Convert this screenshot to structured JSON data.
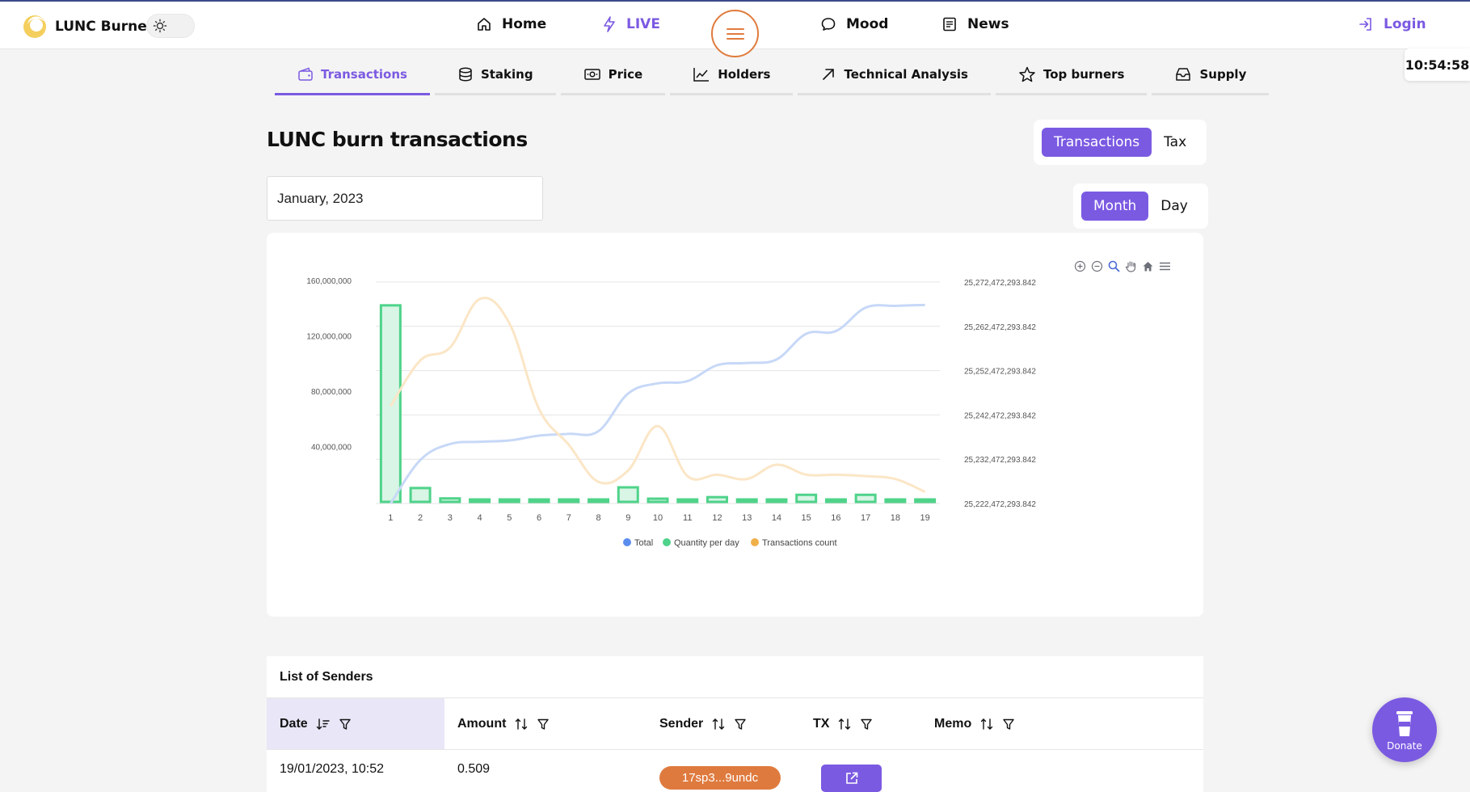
{
  "header": {
    "brand": "LUNC Burner",
    "nav": {
      "home": "Home",
      "live": "LIVE",
      "mood": "Mood",
      "news": "News"
    },
    "login": "Login",
    "clock": "10:54:58"
  },
  "subtabs": [
    "Transactions",
    "Staking",
    "Price",
    "Holders",
    "Technical Analysis",
    "Top burners",
    "Supply"
  ],
  "page": {
    "title": "LUNC burn transactions",
    "type_toggle": {
      "transactions": "Transactions",
      "tax": "Tax"
    },
    "period_toggle": {
      "month": "Month",
      "day": "Day"
    },
    "month_value": "January, 2023"
  },
  "colors": {
    "accent": "#7b5ae2",
    "orange": "#df7a3e",
    "total": "#5b8def",
    "quantity": "#4fd38a",
    "tx_count": "#f0b04a"
  },
  "chart_data": {
    "type": "bar",
    "categories": [
      "1",
      "2",
      "3",
      "4",
      "5",
      "6",
      "7",
      "8",
      "9",
      "10",
      "11",
      "12",
      "13",
      "14",
      "15",
      "16",
      "17",
      "18",
      "19"
    ],
    "series": [
      {
        "name": "Total",
        "type": "line",
        "axis": "right",
        "values": [
          25222472293.842,
          25232300000,
          25235900000,
          25236400000,
          25236700000,
          25237800000,
          25238200000,
          25238800000,
          25247300000,
          25249600000,
          25250100000,
          25253700000,
          25254200000,
          25255000000,
          25260800000,
          25261400000,
          25266700000,
          25267100000,
          25267300000
        ]
      },
      {
        "name": "Quantity per day",
        "type": "bar",
        "axis": "left",
        "values": [
          142000000,
          10000000,
          2500000,
          900000,
          900000,
          1400000,
          800000,
          900000,
          10500000,
          2300000,
          1100000,
          3400000,
          1300000,
          1300000,
          5100000,
          900000,
          5100000,
          1200000,
          900000
        ]
      },
      {
        "name": "Transactions count",
        "type": "line",
        "axis": "hidden",
        "values": [
          67,
          99,
          108,
          142,
          125,
          65,
          40,
          14,
          22,
          53,
          18,
          19,
          16,
          26,
          19,
          19,
          18,
          16,
          7
        ]
      }
    ],
    "y_left": {
      "min": 0,
      "max": 160000000,
      "ticks": [
        "160,000,000",
        "120,000,000",
        "80,000,000",
        "40,000,000"
      ]
    },
    "y_right": {
      "ticks": [
        "25,272,472,293.842",
        "25,262,472,293.842",
        "25,252,472,293.842",
        "25,242,472,293.842",
        "25,232,472,293.842",
        "25,222,472,293.842"
      ]
    },
    "legend": [
      "Total",
      "Quantity per day",
      "Transactions count"
    ],
    "legend_position": "bottom-center",
    "grid": true
  },
  "senders": {
    "title": "List of Senders",
    "columns": [
      "Date",
      "Amount",
      "Sender",
      "TX",
      "Memo"
    ],
    "rows": [
      {
        "date": "19/01/2023, 10:52",
        "amount": "0.509",
        "sender": "17sp3...9undc"
      }
    ]
  },
  "donate": "Donate"
}
